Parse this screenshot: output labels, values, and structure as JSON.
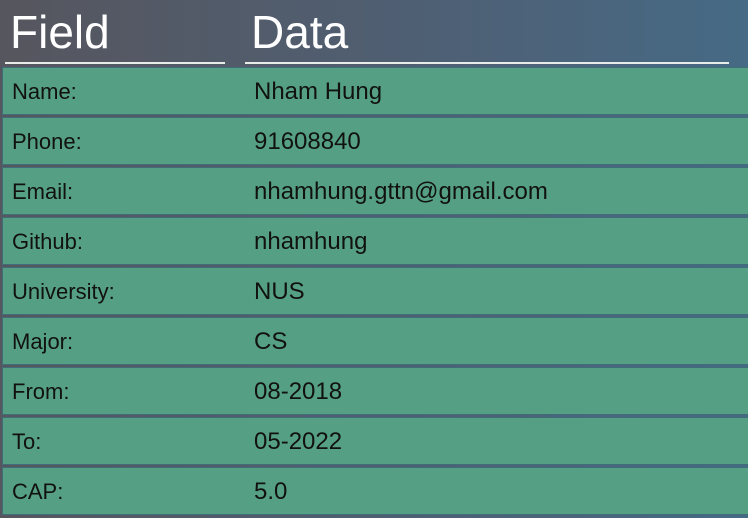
{
  "header": {
    "field_label": "Field",
    "data_label": "Data"
  },
  "rows": [
    {
      "field": "Name:",
      "value": "Nham Hung"
    },
    {
      "field": "Phone:",
      "value": "91608840"
    },
    {
      "field": "Email:",
      "value": "nhamhung.gttn@gmail.com"
    },
    {
      "field": "Github:",
      "value": "nhamhung"
    },
    {
      "field": "University:",
      "value": "NUS"
    },
    {
      "field": "Major:",
      "value": "CS"
    },
    {
      "field": "From:",
      "value": "08-2018"
    },
    {
      "field": "To:",
      "value": "05-2022"
    },
    {
      "field": "CAP:",
      "value": "5.0"
    }
  ],
  "colors": {
    "row_background": "#55a085",
    "row_border": "#3f6e78",
    "header_text": "#ffffff"
  }
}
